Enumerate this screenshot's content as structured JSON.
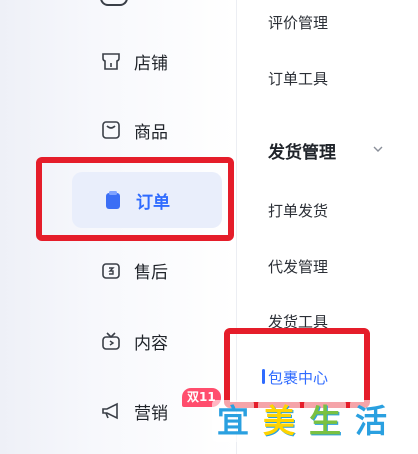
{
  "nav": {
    "items": [
      {
        "label": "店铺",
        "icon": "shop-icon"
      },
      {
        "label": "商品",
        "icon": "product-icon"
      },
      {
        "label": "订单",
        "icon": "order-icon",
        "active": true
      },
      {
        "label": "售后",
        "icon": "after-sales-icon"
      },
      {
        "label": "内容",
        "icon": "content-icon"
      },
      {
        "label": "营销",
        "icon": "marketing-icon",
        "badge": "双11"
      }
    ]
  },
  "submenu": {
    "top_items": [
      "评价管理",
      "订单工具"
    ],
    "group": {
      "label": "发货管理",
      "expanded": true
    },
    "group_items": [
      "打单发货",
      "代发管理",
      "发货工具",
      "包裹中心"
    ]
  },
  "watermark": {
    "text": [
      "宜",
      "美",
      "生",
      "活"
    ]
  },
  "colors": {
    "accent": "#2f6bff",
    "highlight_box": "#e51d2a",
    "active_bg": "#e9eefb"
  }
}
